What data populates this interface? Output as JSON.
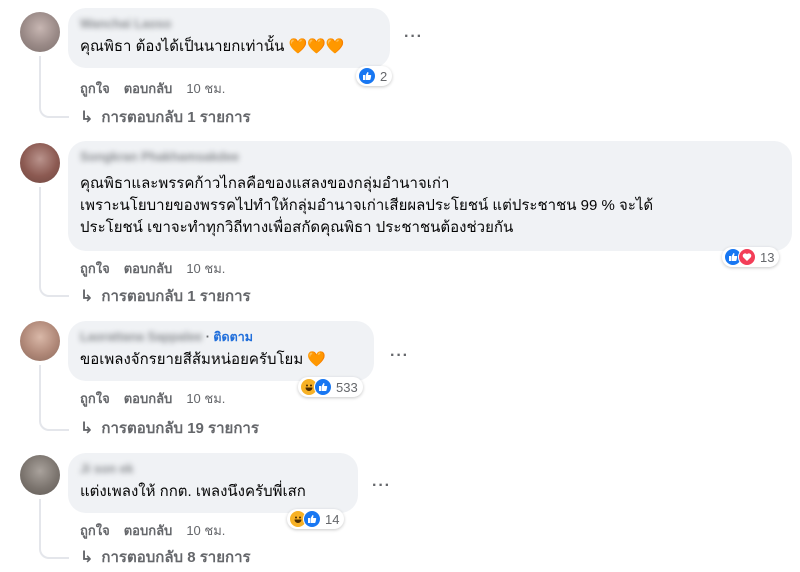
{
  "comments": [
    {
      "author": "Wanchai Laoso",
      "follow": "",
      "text": "คุณพิธา ต้องได้เป็นนายกเท่านั้น 🧡🧡🧡",
      "reactions": [
        "like"
      ],
      "reaction_count": "2",
      "like_label": "ถูกใจ",
      "reply_label": "ตอบกลับ",
      "time": "10 ชม.",
      "replies": "การตอบกลับ 1 รายการ"
    },
    {
      "author": "Songkran Phakhamsakdee",
      "follow": "",
      "text": "คุณพิธาและพรรคก้าวไกลคือของแสลงของกลุ่มอำนาจเก่า\nเพราะนโยบายของพรรคไปทำให้กลุ่มอำนาจเก่าเสียผลประโยชน์ แต่ประชาชน 99 % จะได้\nประโยชน์ เขาจะทำทุกวิถีทางเพื่อสกัดคุณพิธา ประชาชนต้องช่วยกัน",
      "reactions": [
        "like",
        "love"
      ],
      "reaction_count": "13",
      "like_label": "ถูกใจ",
      "reply_label": "ตอบกลับ",
      "time": "10 ชม.",
      "replies": "การตอบกลับ 1 รายการ"
    },
    {
      "author": "Laorattana Sappalee",
      "follow": "ติดตาม",
      "text": "ขอเพลงจักรยายสีส้มหน่อยครับโยม 🧡",
      "reactions": [
        "haha",
        "like"
      ],
      "reaction_count": "533",
      "like_label": "ถูกใจ",
      "reply_label": "ตอบกลับ",
      "time": "10 ชม.",
      "replies": "การตอบกลับ 19 รายการ"
    },
    {
      "author": "Ji son ek",
      "follow": "",
      "text": "แต่งเพลงให้ กกต. เพลงนึงครับพี่เสก",
      "reactions": [
        "haha",
        "like"
      ],
      "reaction_count": "14",
      "like_label": "ถูกใจ",
      "reply_label": "ตอบกลับ",
      "time": "10 ชม.",
      "replies": "การตอบกลับ 8 รายการ"
    }
  ],
  "colors": {
    "bubble": "#f0f2f5",
    "muted": "#65676b",
    "like": "#1877f2",
    "love": "#f33e58",
    "haha": "#f7b125",
    "follow": "#216fdb"
  },
  "icons": {
    "more": "more-horizontal-icon",
    "reply_arrow": "reply-arrow-icon"
  }
}
